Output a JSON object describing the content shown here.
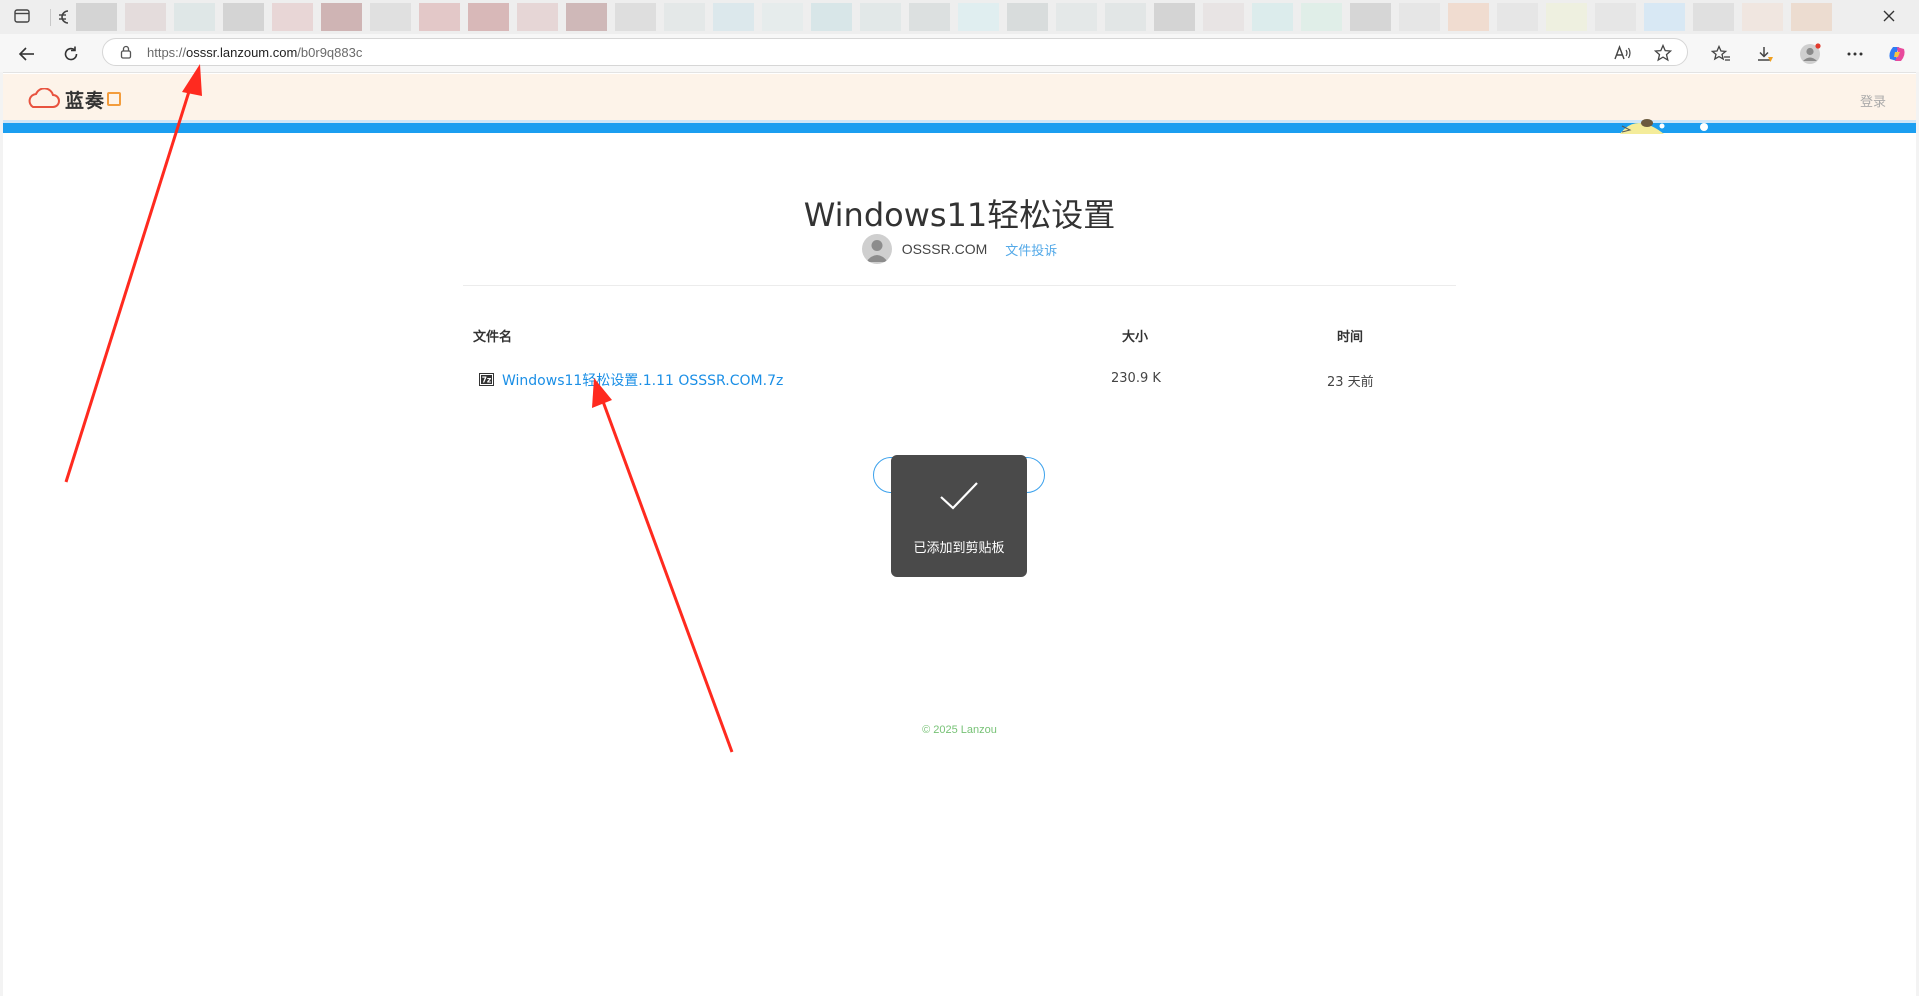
{
  "browser": {
    "address_prefix": "https://",
    "address_host": "osssr.lanzoum.com",
    "address_path": "/b0r9q883c",
    "tab_blur_colors": [
      "#d4d4d4",
      "#e4dcdc",
      "#dfe7e7",
      "#d4d4d4",
      "#e8d6d6",
      "#cfb4b4",
      "#e0e0e0",
      "#e3c8c8",
      "#d8b8b8",
      "#e6d6d6",
      "#cfb8b8",
      "#dedede",
      "#e4e8e8",
      "#dce8ec",
      "#e6ecec",
      "#d8e6e8",
      "#e2e8e8",
      "#dce0e0",
      "#e0eef0",
      "#d8dcdc",
      "#e4e8e8",
      "#e2e6e6",
      "#d4d4d4",
      "#e8e4e4",
      "#dcecec",
      "#e0eee8",
      "#d6d6d6",
      "#e6e6e6",
      "#f0dcd0",
      "#e6e6e6",
      "#eef0e0",
      "#e6e6e6",
      "#d8e8f4",
      "#e0e0e0",
      "#f0e6e0",
      "#ecdcd0"
    ]
  },
  "site": {
    "logo_text": "蓝奏",
    "login_label": "登录"
  },
  "file": {
    "title": "Windows11轻松设置",
    "uploader": "OSSSR.COM",
    "report_label": "文件投诉"
  },
  "table": {
    "headers": {
      "name": "文件名",
      "size": "大小",
      "time": "时间"
    },
    "rows": [
      {
        "name": "Windows11轻松设置.1.11 OSSSR.COM.7z",
        "size": "230.9 K",
        "time": "23 天前"
      }
    ]
  },
  "toast": {
    "message": "已添加到剪贴板"
  },
  "footer": {
    "copyright": "© 2025 Lanzou"
  },
  "colors": {
    "accent_blue": "#1b9ef0",
    "link_blue": "#1b8fe6",
    "annotation_red": "#ff2a1f",
    "header_bg": "#fdf3e9",
    "footer_green": "#77c276"
  },
  "icons": {
    "toolbar": [
      "back-icon",
      "refresh-icon",
      "lock-icon",
      "read-aloud-icon",
      "favorite-star-icon",
      "favorites-list-icon",
      "download-icon",
      "profile-icon",
      "more-icon",
      "copilot-icon"
    ]
  }
}
